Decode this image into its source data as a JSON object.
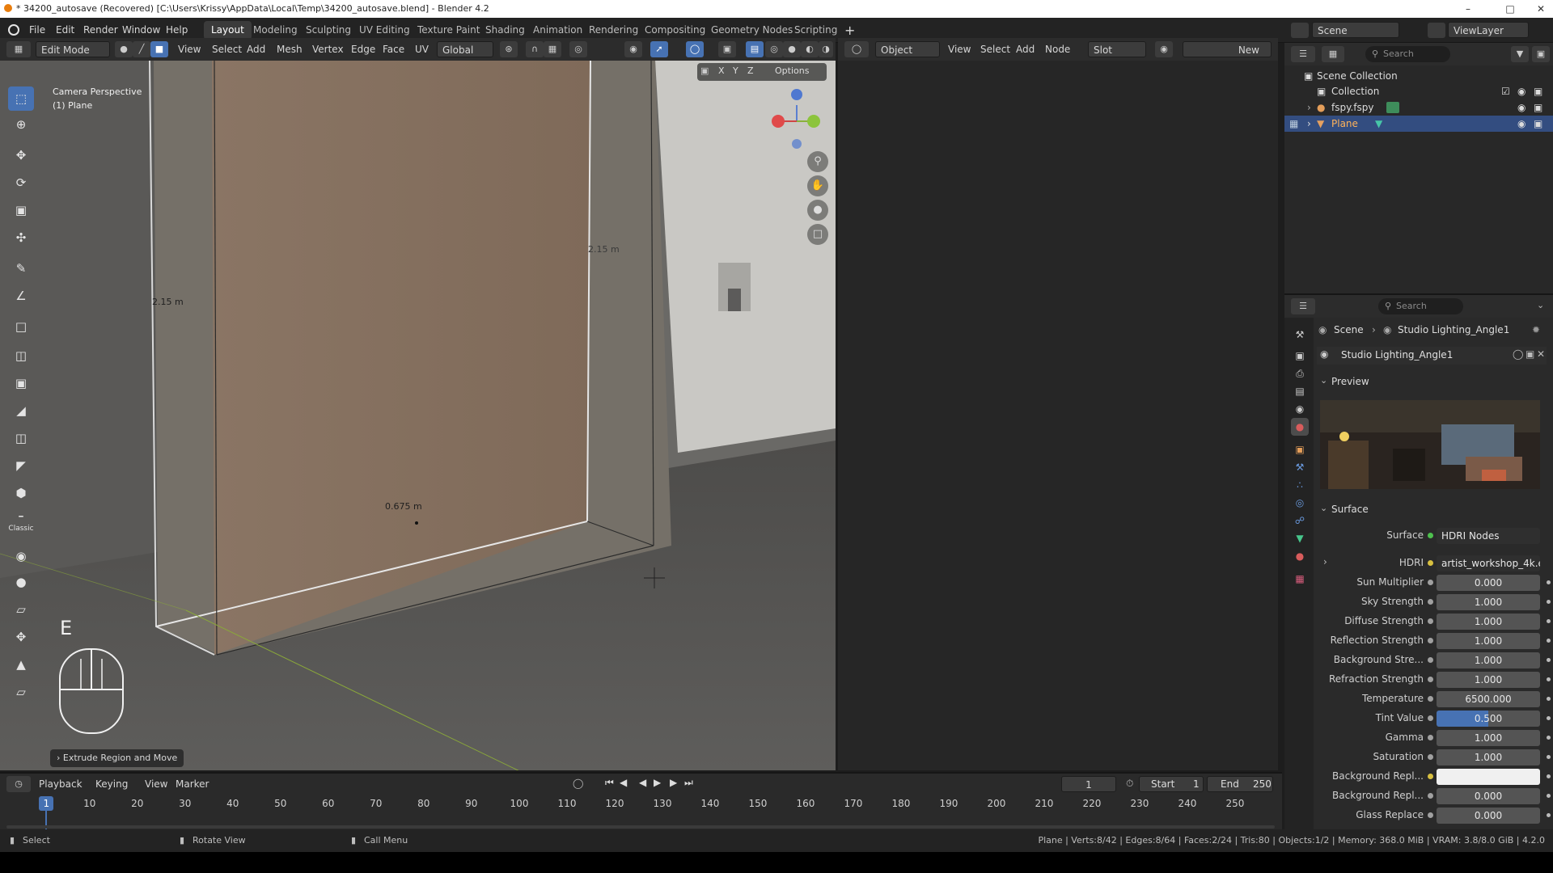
{
  "titlebar": {
    "title": "* 34200_autosave (Recovered) [C:\\Users\\Krissy\\AppData\\Local\\Temp\\34200_autosave.blend] - Blender 4.2"
  },
  "menus": [
    "File",
    "Edit",
    "Render",
    "Window",
    "Help"
  ],
  "workspaces": [
    "Layout",
    "Modeling",
    "Sculpting",
    "UV Editing",
    "Texture Paint",
    "Shading",
    "Animation",
    "Rendering",
    "Compositing",
    "Geometry Nodes",
    "Scripting"
  ],
  "top_right": {
    "scene": "Scene",
    "view_layer": "ViewLayer"
  },
  "viewport_header": {
    "mode": "Edit Mode",
    "menus": [
      "View",
      "Select",
      "Add",
      "Mesh",
      "Vertex",
      "Edge",
      "Face",
      "UV"
    ],
    "transform": "Global",
    "options": "Options",
    "axes": [
      "X",
      "Y",
      "Z"
    ]
  },
  "viewport": {
    "camera_label": "Camera Perspective",
    "object_label": "(1) Plane",
    "dim_left": "2.15 m",
    "dim_right": "2.15 m",
    "dim_bottom": "0.675 m",
    "key_hint": "E",
    "last_op": "Extrude Region and Move",
    "classic_label": "Classic"
  },
  "node_header": {
    "object": "Object",
    "menus": [
      "View",
      "Select",
      "Add",
      "Node"
    ],
    "slot": "Slot",
    "new": "New"
  },
  "outliner": {
    "search_placeholder": "Search",
    "root": "Scene Collection",
    "collection": "Collection",
    "items": [
      {
        "name": "fspy.fspy"
      },
      {
        "name": "Plane"
      }
    ]
  },
  "properties": {
    "search_placeholder": "Search",
    "breadcrumb_scene": "Scene",
    "breadcrumb_world": "Studio Lighting_Angle1",
    "world_name": "Studio Lighting_Angle1",
    "preview_label": "Preview",
    "surface_panel": "Surface",
    "rows": [
      {
        "label": "Surface",
        "value": "HDRI Nodes"
      },
      {
        "label": "HDRI",
        "value": "artist_workshop_4k.exr..."
      },
      {
        "label": "Sun Multiplier",
        "value": "0.000"
      },
      {
        "label": "Sky Strength",
        "value": "1.000"
      },
      {
        "label": "Diffuse Strength",
        "value": "1.000"
      },
      {
        "label": "Reflection Strength",
        "value": "1.000"
      },
      {
        "label": "Background Stre...",
        "value": "1.000"
      },
      {
        "label": "Refraction Strength",
        "value": "1.000"
      },
      {
        "label": "Temperature",
        "value": "6500.000"
      },
      {
        "label": "Tint Value",
        "value": "0.500"
      },
      {
        "label": "Gamma",
        "value": "1.000"
      },
      {
        "label": "Saturation",
        "value": "1.000"
      },
      {
        "label": "Background Repl...",
        "value": ""
      },
      {
        "label": "Background Repl...",
        "value": "0.000"
      },
      {
        "label": "Glass Replace",
        "value": "0.000"
      }
    ]
  },
  "timeline": {
    "menus": [
      "Playback",
      "Keying",
      "View",
      "Marker"
    ],
    "current_frame": "1",
    "start_label": "Start",
    "start": "1",
    "end_label": "End",
    "end": "250",
    "ticks": [
      "1",
      "10",
      "20",
      "30",
      "40",
      "50",
      "60",
      "70",
      "80",
      "90",
      "100",
      "110",
      "120",
      "130",
      "140",
      "150",
      "160",
      "170",
      "180",
      "190",
      "200",
      "210",
      "220",
      "230",
      "240",
      "250"
    ]
  },
  "statusbar": {
    "select": "Select",
    "rotate": "Rotate View",
    "call_menu": "Call Menu",
    "stats": "Plane | Verts:8/42 | Edges:8/64 | Faces:2/24 | Tris:80 | Objects:1/2 | Memory: 368.0 MiB | VRAM: 3.8/8.0 GiB | 4.2.0"
  },
  "colors": {
    "accent": "#4772b3",
    "header": "#2c2c2c",
    "panel": "#2a2a2a"
  }
}
